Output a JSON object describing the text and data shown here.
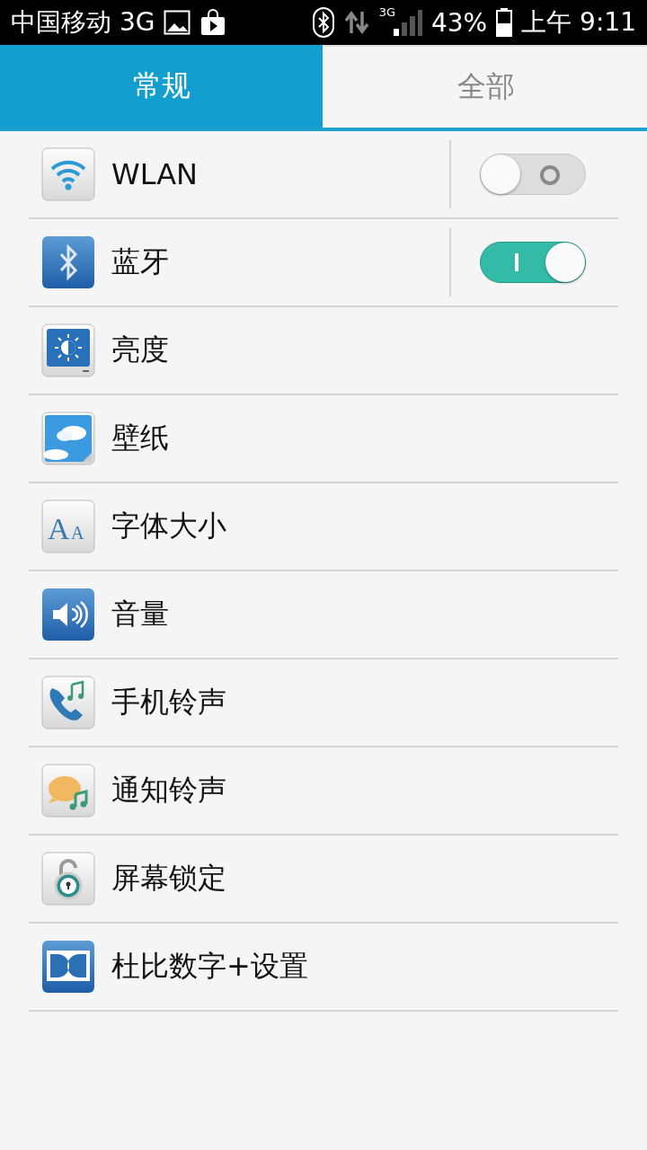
{
  "status_bar": {
    "carrier": "中国移动 3G",
    "network": "3G",
    "battery": "43%",
    "time": "上午 9:11"
  },
  "tabs": [
    {
      "label": "常规",
      "selected": true
    },
    {
      "label": "全部",
      "selected": false
    }
  ],
  "items": [
    {
      "label": "WLAN",
      "kind": "toggle",
      "on": false
    },
    {
      "label": "蓝牙",
      "kind": "toggle",
      "on": true
    },
    {
      "label": "亮度",
      "kind": "plain"
    },
    {
      "label": "壁纸",
      "kind": "plain"
    },
    {
      "label": "字体大小",
      "icon_letters": [
        "A",
        "A"
      ],
      "kind": "plain"
    },
    {
      "label": "音量",
      "kind": "plain"
    },
    {
      "label": "手机铃声",
      "kind": "plain"
    },
    {
      "label": "通知铃声",
      "kind": "plain"
    },
    {
      "label": "屏幕锁定",
      "kind": "plain"
    },
    {
      "label": "杜比数字+设置",
      "kind": "plain"
    }
  ]
}
